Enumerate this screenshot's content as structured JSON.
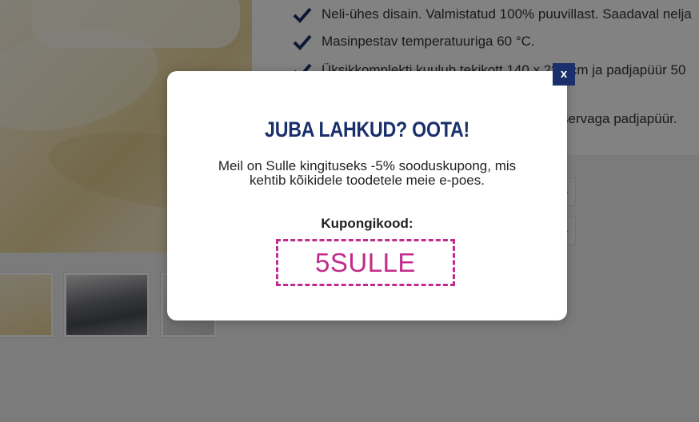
{
  "background": {
    "bullets": [
      "Neli-ühes disain. Valmistatud 100% puuvillast. Saadaval nelja",
      "Masinpestav temperatuuriga 60 °C.",
      "Üksikkomplekti kuulub tekikott 140 x 2?? cm ja padjapüür 50",
      "servaga padjapüür."
    ],
    "check_icon": "checkmark-icon",
    "accent_color": "#1a2f6b"
  },
  "modal": {
    "close_label": "x",
    "title": "JUBA LAHKUD? OOTA!",
    "description": "Meil on Sulle kingituseks -5% sooduskupong, mis kehtib kõikidele toodetele meie e-poes.",
    "coupon_label": "Kupongikood:",
    "coupon_code": "5SULLE",
    "title_color": "#1a2f6b",
    "coupon_color": "#c22b8c"
  }
}
